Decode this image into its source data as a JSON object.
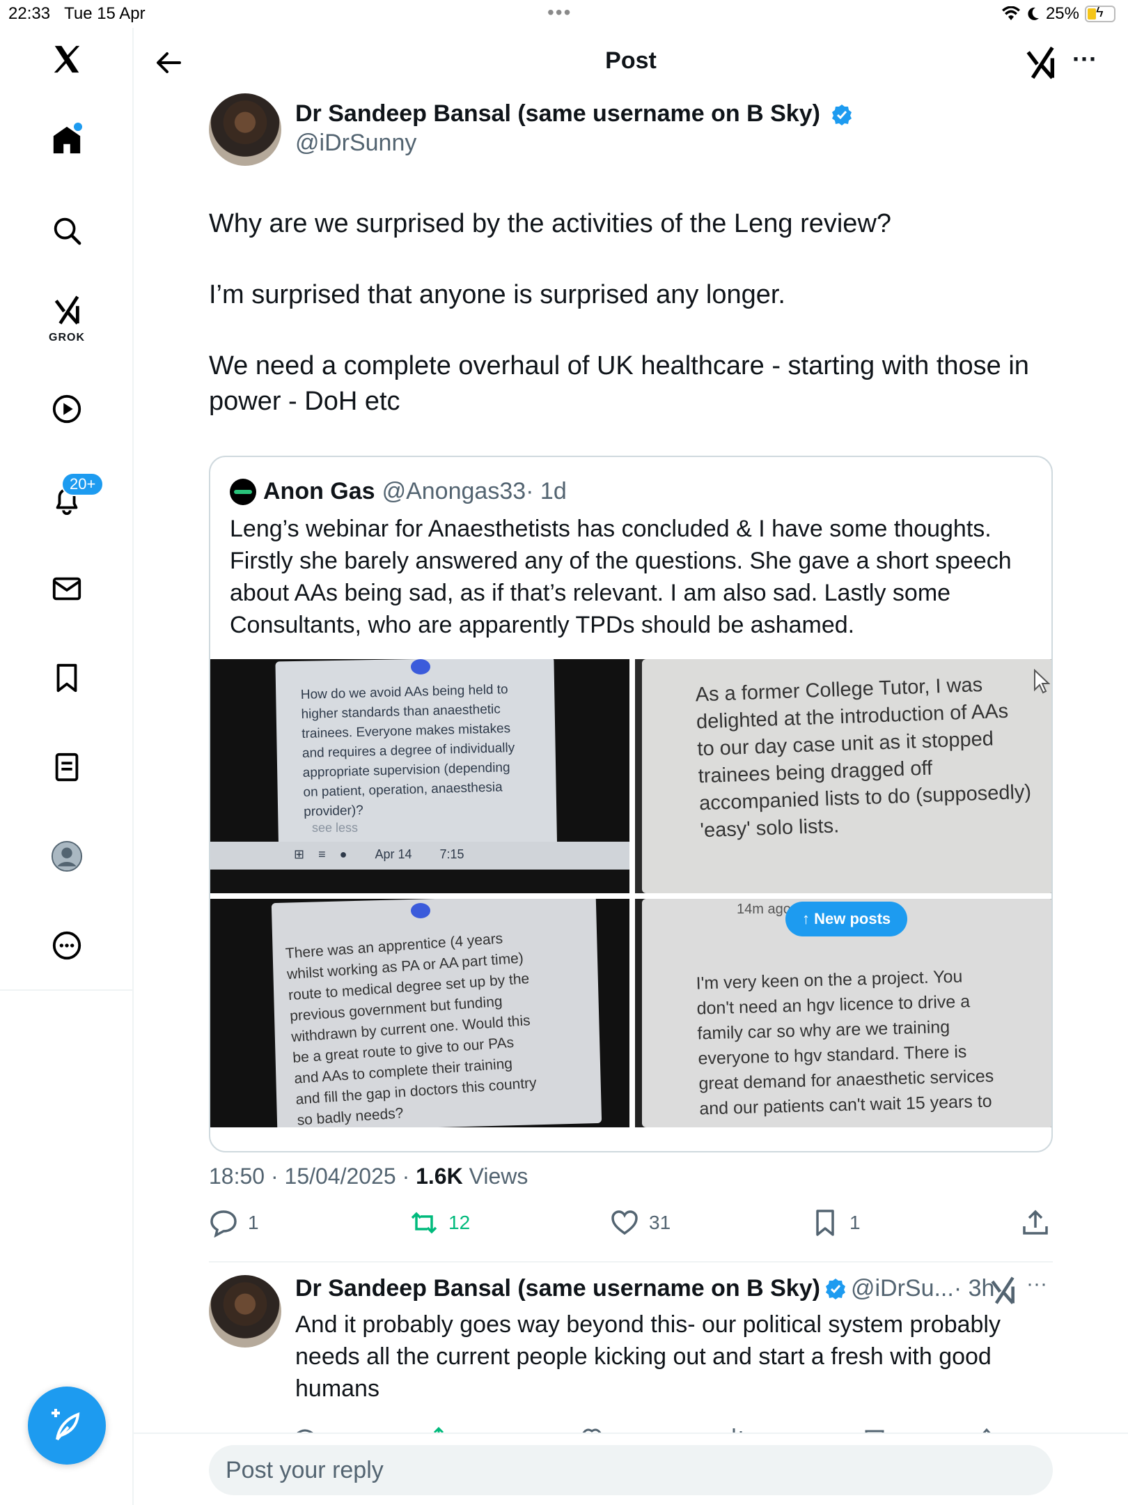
{
  "status_bar": {
    "time": "22:33",
    "date": "Tue 15 Apr",
    "battery": "25%"
  },
  "sidebar": {
    "badge_notifications": "20+",
    "grok_label": "GROK",
    "items": [
      "home-icon",
      "search-icon",
      "grok-icon",
      "video-icon",
      "bell-icon",
      "mail-icon",
      "bookmark-icon",
      "lists-icon",
      "profile-icon",
      "more-icon"
    ]
  },
  "header": {
    "title": "Post"
  },
  "post": {
    "author_name": "Dr Sandeep Bansal (same username on B Sky)",
    "author_handle": "@iDrSunny",
    "paragraphs": [
      "Why are we surprised by the activities of the Leng review?",
      "I’m surprised that anyone is surprised any longer.",
      "We need a complete overhaul of UK healthcare - starting with those in power - DoH etc"
    ],
    "timestamp": "18:50 · 15/04/2025 · ",
    "views_count": "1.6K",
    "views_label": " Views",
    "replies": "1",
    "reposts": "12",
    "likes": "31",
    "bookmarks": "1"
  },
  "quote": {
    "author_name": "Anon Gas",
    "author_handle": "@Anongas33",
    "age": " · 1d",
    "text": "Leng’s webinar for Anaesthetists has concluded & I have some thoughts. Firstly she barely answered any of the questions. She gave a short speech about AAs being sad, as if that’s relevant. I am also sad. Lastly some Consultants, who are apparently TPDs should be ashamed.",
    "photo1_text": "How do we avoid AAs being held to\nhigher standards than anaesthetic\ntrainees. Everyone makes mistakes\nand requires a degree of individually\nappropriate supervision (depending\non patient, operation, anaesthesia\nprovider)?",
    "photo1_seeless": "see less",
    "photo1_date": "Apr 14",
    "photo1_time": "7:15",
    "photo2_text": "As a former College Tutor, I was\ndelighted at the introduction of AAs\nto our day case unit as it stopped\ntrainees being dragged off\naccompanied lists to do (supposedly)\n'easy' solo lists.",
    "photo3_text": "There was an apprentice (4 years\nwhilst working as PA or AA part time)\nroute to medical degree set up by the\nprevious government but funding\nwithdrawn by current one. Would this\nbe a great route to give to our PAs\nand AAs to complete their training\nand fill the gap in doctors this country\nso badly needs?",
    "photo4_age": "14m ago",
    "photo4_newposts": "↑ New posts",
    "photo4_text": "I'm very keen on the a project. You\ndon't need an hgv licence to drive a\nfamily car so why are we training\neveryone to hgv standard. There is\ngreat demand for anaesthetic services\nand our patients can't wait 15 years to"
  },
  "reply": {
    "author_name": "Dr Sandeep Bansal (same username on B Sky)",
    "author_handle": "@iDrSu...",
    "age": " · 3h",
    "text": "And it probably goes way beyond this- our political system probably needs all the current people kicking out and start a fresh with good humans"
  },
  "composer": {
    "placeholder": "Post your reply"
  },
  "colors": {
    "accent": "#1d9bf0",
    "repost_green": "#00ba7c",
    "muted_text": "#536471"
  }
}
